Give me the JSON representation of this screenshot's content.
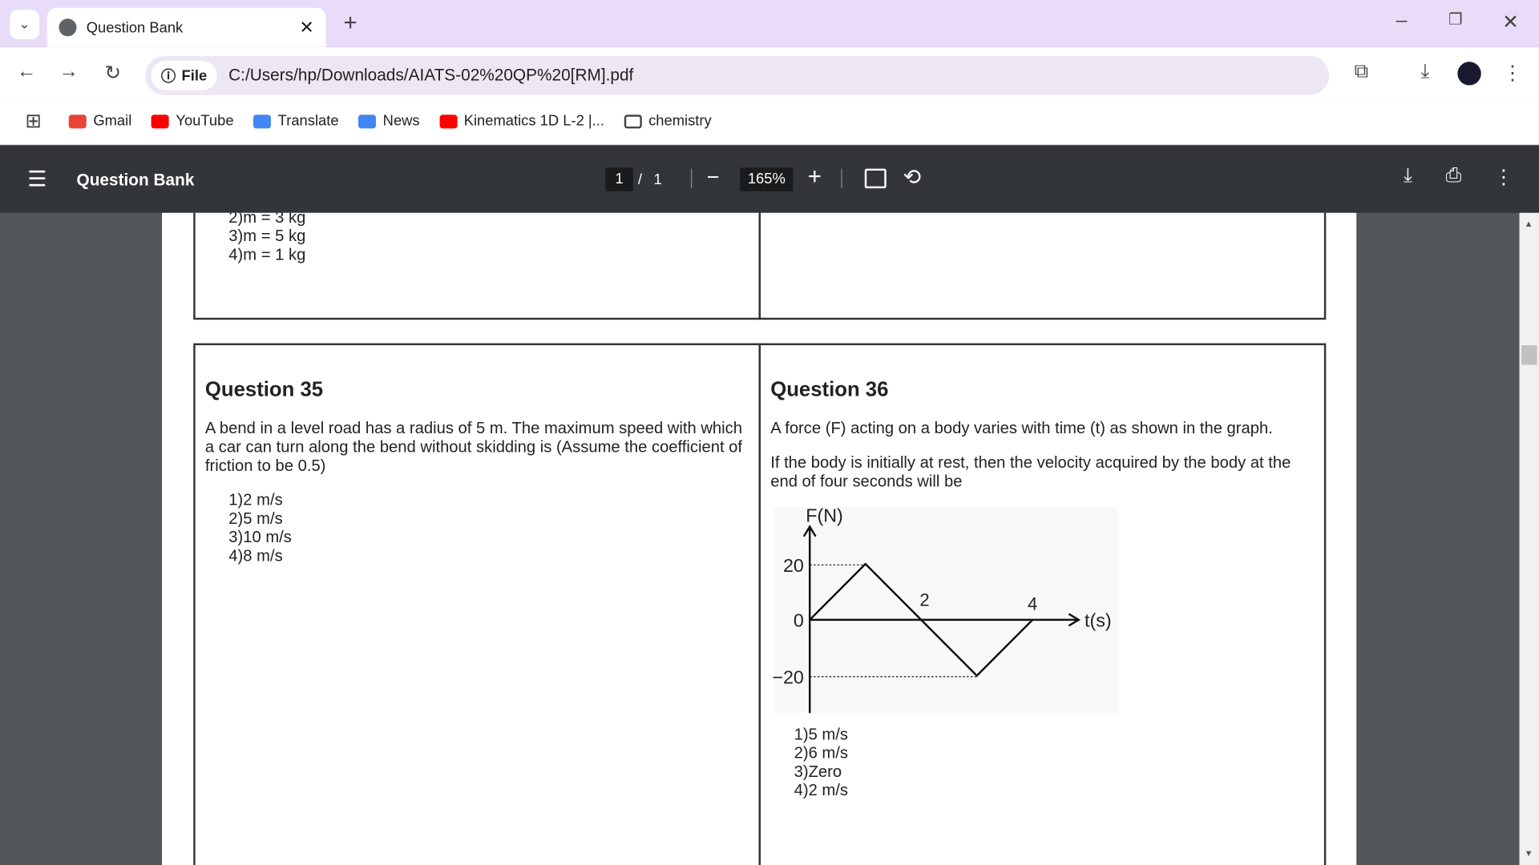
{
  "browser": {
    "tab_title": "Question Bank",
    "url": "C:/Users/hp/Downloads/AIATS-02%20QP%20[RM].pdf",
    "scheme_chip": "File",
    "bookmarks": [
      {
        "label": "Gmail",
        "color": "#ea4335"
      },
      {
        "label": "YouTube",
        "color": "#ff0000"
      },
      {
        "label": "Translate",
        "color": "#4285f4"
      },
      {
        "label": "News",
        "color": "#4285f4"
      },
      {
        "label": "Kinematics 1D L-2 |...",
        "color": "#ff0000"
      },
      {
        "label": "chemistry",
        "color": "#444444"
      }
    ]
  },
  "viewer": {
    "title": "Question Bank",
    "page_current": "1",
    "page_sep": "/",
    "page_total": "1",
    "zoom": "165%"
  },
  "prev_options": [
    "2)m = 3 kg",
    "3)m = 5 kg",
    "4)m = 1 kg"
  ],
  "q35": {
    "title": "Question 35",
    "text": "A bend in a level road has a radius of 5 m. The maximum speed with which a car can turn along the bend without skidding is (Assume the coefficient of friction to be 0.5)",
    "options": [
      "1)2 m/s",
      "2)5 m/s",
      "3)10 m/s",
      "4)8 m/s"
    ]
  },
  "q36": {
    "title": "Question 36",
    "text1": "A force (F) acting on a body varies with time (t) as shown in the graph.",
    "text2": "If the body is initially at rest, then the velocity acquired by the body at the end of four seconds will be",
    "options": [
      "1)5 m/s",
      "2)6 m/s",
      "3)Zero",
      "4)2 m/s"
    ],
    "figure": {
      "ylabel": "F(N)",
      "xlabel": "t(s)",
      "yticks": [
        "20",
        "0",
        "−20"
      ],
      "xticks": [
        "2",
        "4"
      ],
      "points": [
        [
          0,
          0
        ],
        [
          1,
          20
        ],
        [
          2,
          0
        ],
        [
          3,
          -20
        ],
        [
          4,
          0
        ]
      ]
    }
  }
}
